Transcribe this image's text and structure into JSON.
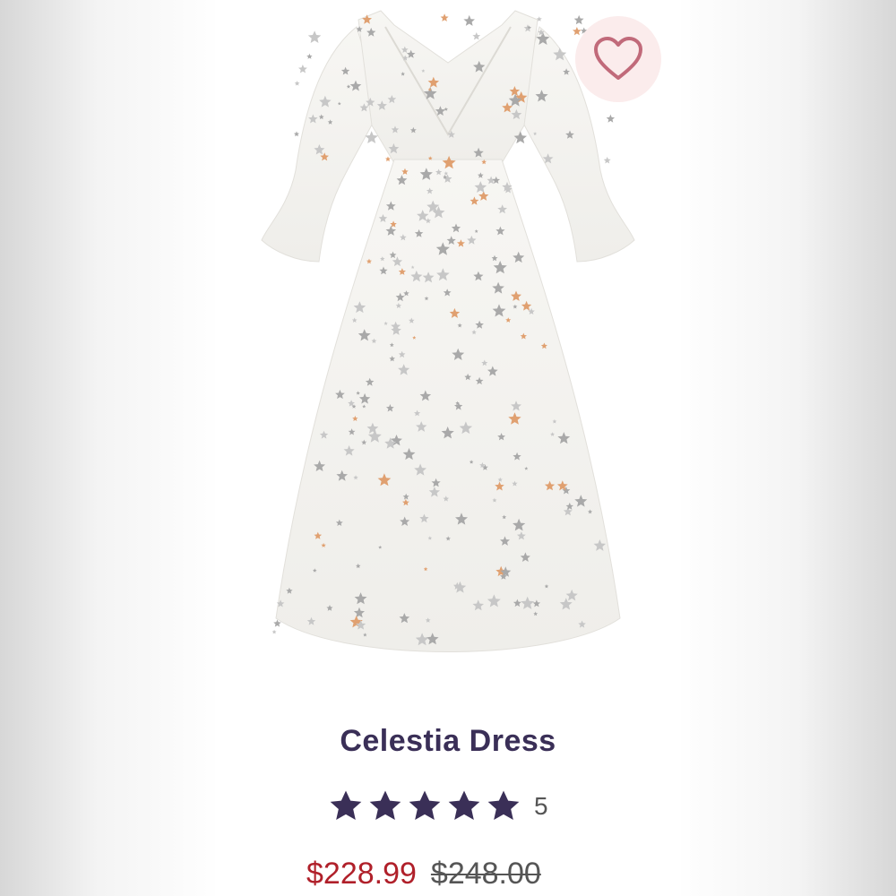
{
  "product": {
    "name": "Celestia Dress",
    "rating": 5,
    "rating_count": "5",
    "sale_price": "$228.99",
    "original_price": "$248.00"
  },
  "wishlist": {
    "icon": "heart-outline-icon",
    "color": "#c16a7a",
    "bg": "#fbecec"
  },
  "colors": {
    "title": "#3a2f57",
    "stars": "#3a2f57",
    "sale": "#b0202a",
    "strike": "#555555"
  }
}
